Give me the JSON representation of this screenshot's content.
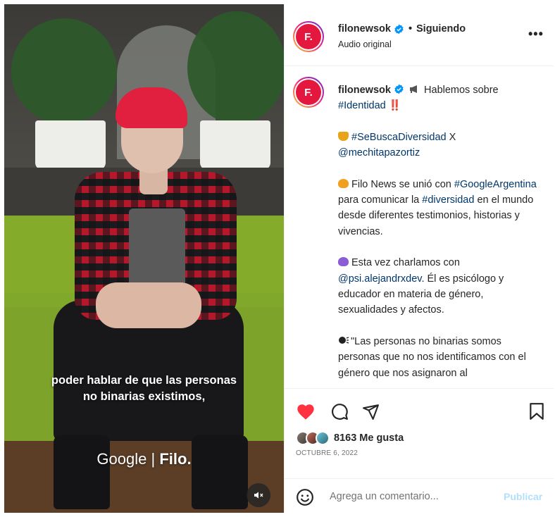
{
  "video": {
    "subtitle_line1": "poder hablar de que las personas",
    "subtitle_line2": "no binarias existimos,",
    "watermark_left": "Google",
    "watermark_sep": "|",
    "watermark_right": "Filo.",
    "mute_icon": "volume-muted-icon"
  },
  "header": {
    "avatar_text": "F.",
    "username": "filonewsok",
    "separator": "•",
    "follow_status": "Siguiendo",
    "audio": "Audio original",
    "more": "•••"
  },
  "caption": {
    "avatar_text": "F.",
    "username": "filonewsok",
    "intro_text": "Hablemos sobre",
    "intro_tag": "#Identidad",
    "intro_end": " ‼️",
    "p2_tag": "#SeBuscaDiversidad",
    "p2_mid": " X",
    "p2_mention": "@mechitapazortiz",
    "p3_a": "Filo News se unió con ",
    "p3_tag1": "#GoogleArgentina",
    "p3_b": " para comunicar la ",
    "p3_tag2": "#diversidad",
    "p3_c": " en el mundo desde diferentes testimonios, historias y vivencias.",
    "p4_a": "Esta vez charlamos con ",
    "p4_mention": "@psi.alejandrxdev",
    "p4_b": ". Él es psicólogo y educador en materia de género, sexualidades y afectos.",
    "p5": "\"Las personas no binarias somos personas que no nos identificamos con el género que nos asignaron al"
  },
  "actions": {
    "likes": "8163 Me gusta",
    "date": "OCTUBRE 6, 2022",
    "comment_placeholder": "Agrega un comentario...",
    "publish": "Publicar"
  },
  "colors": {
    "like_red": "#ff3040",
    "link_blue": "#00376b",
    "verified_blue": "#0095f6",
    "publish_disabled": "#b2dffc",
    "brand_red": "#e4173e"
  }
}
